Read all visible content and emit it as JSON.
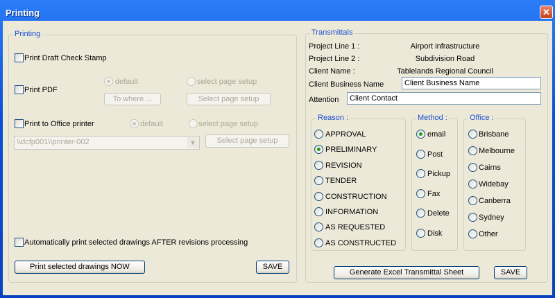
{
  "window": {
    "title": "Printing"
  },
  "printing": {
    "group_label": "Printing",
    "draft_stamp": "Print Draft Check Stamp",
    "pdf": "Print PDF",
    "pdf_default": "default",
    "pdf_select_setup": "select  page setup",
    "to_where": "To where ...",
    "pdf_select_button": "Select page setup",
    "office": "Print to Office printer",
    "office_default": "default",
    "office_select_setup": "select  page setup",
    "printer_value": "\\\\dcfp001\\\\printer-002",
    "office_select_button": "Select page setup",
    "auto_print": "Automatically print selected drawings AFTER revisions processing",
    "print_now": "Print selected drawings NOW",
    "save": "SAVE"
  },
  "transmittals": {
    "group_label": "Transmittals",
    "rows": [
      {
        "label": "Project Line 1 :",
        "value": "Airport infrastructure"
      },
      {
        "label": "Project Line 2 :",
        "value": "Subdivision Road"
      },
      {
        "label": "Client Name :",
        "value": "Tablelands Regional Council"
      }
    ],
    "business_label": "Client Business Name",
    "business_value": "Client Business Name",
    "attention_label": "Attention",
    "attention_value": "Client Contact",
    "reason_label": "Reason :",
    "reasons": [
      "APPROVAL",
      "PRELIMINARY",
      "REVISION",
      "TENDER",
      "CONSTRUCTION",
      "INFORMATION",
      "AS REQUESTED",
      "AS CONSTRUCTED"
    ],
    "reason_selected": "PRELIMINARY",
    "method_label": "Method :",
    "methods": [
      "email",
      "Post",
      "Pickup",
      "Fax",
      "Delete",
      "Disk"
    ],
    "method_selected": "email",
    "office_label": "Office :",
    "offices": [
      "Brisbane",
      "Melbourne",
      "Cairns",
      "Widebay",
      "Canberra",
      "Sydney",
      "Other"
    ],
    "generate": "Generate Excel Transmittal Sheet",
    "save": "SAVE"
  }
}
